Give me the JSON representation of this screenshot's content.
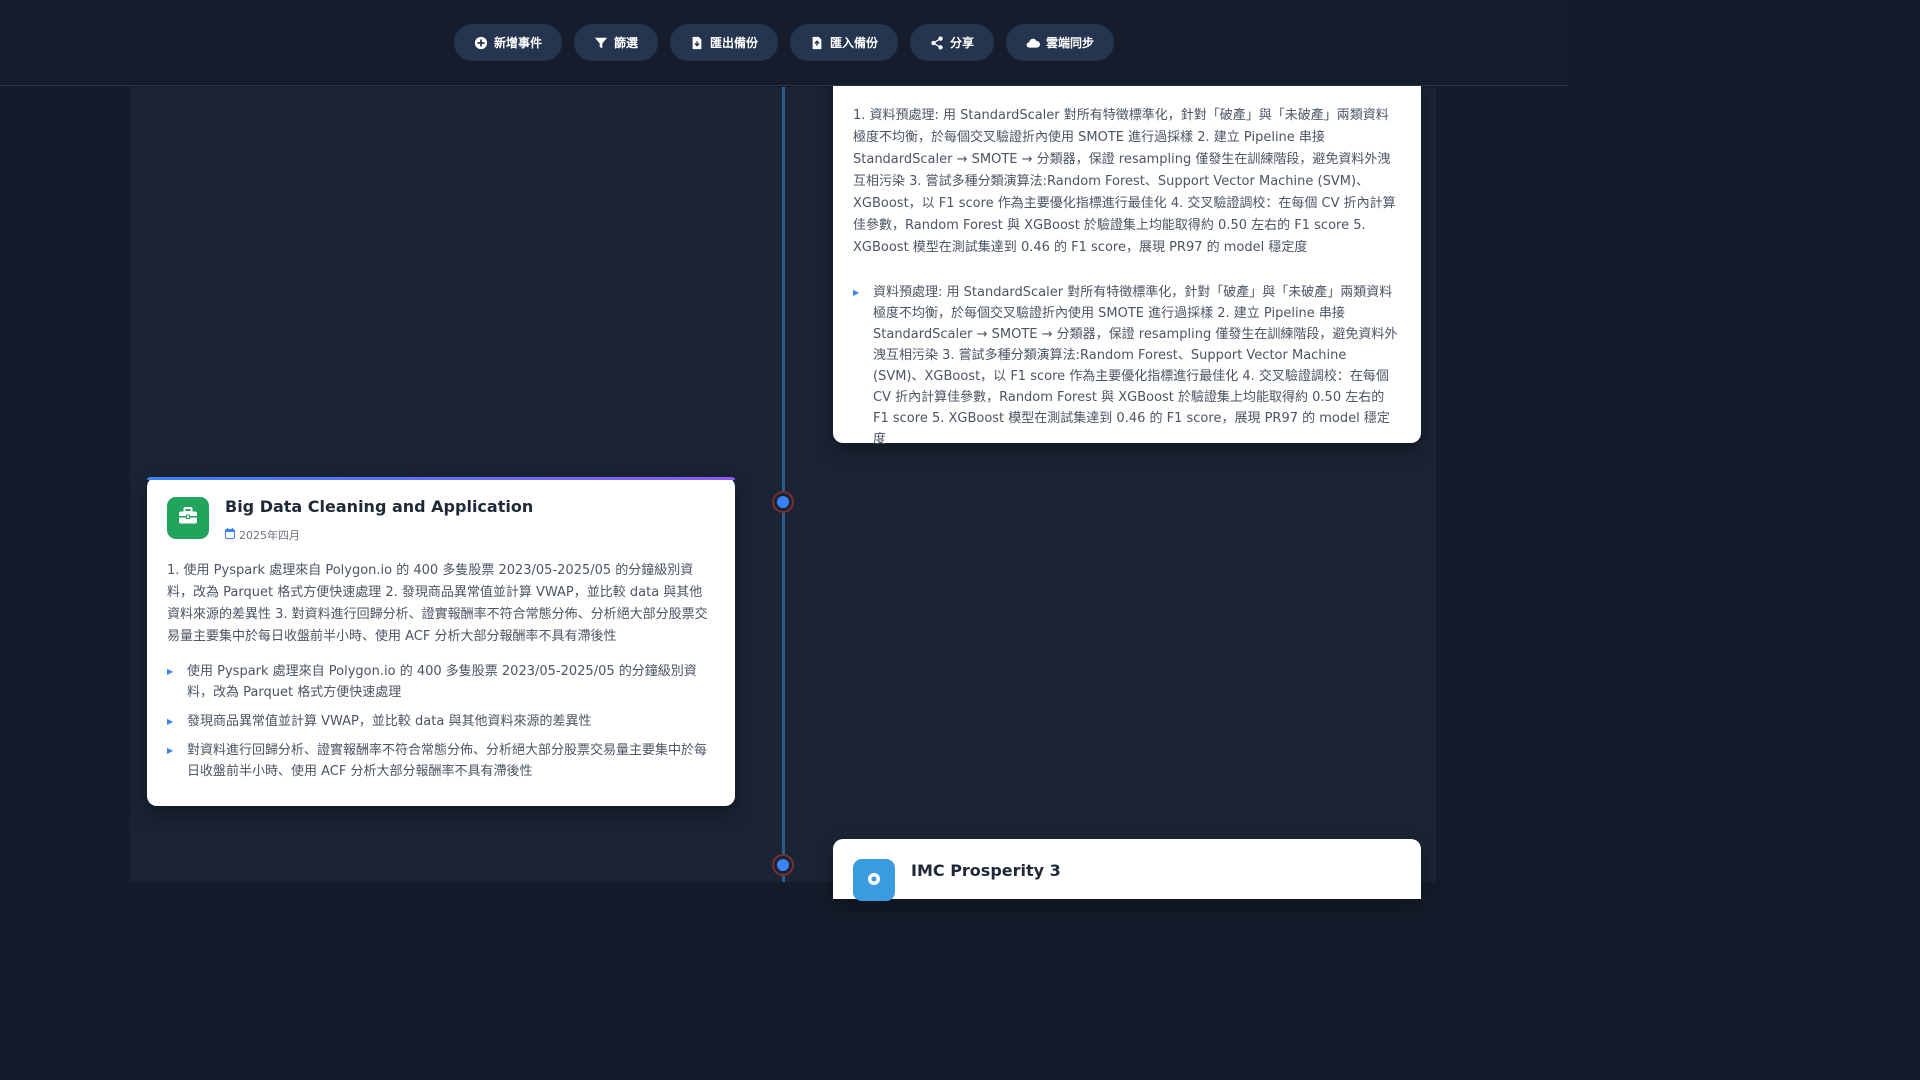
{
  "toolbar": {
    "buttons": [
      {
        "label": "新增事件",
        "icon": "plus-circle-icon"
      },
      {
        "label": "篩選",
        "icon": "filter-icon"
      },
      {
        "label": "匯出備份",
        "icon": "file-export-icon"
      },
      {
        "label": "匯入備份",
        "icon": "file-import-icon"
      },
      {
        "label": "分享",
        "icon": "share-icon"
      },
      {
        "label": "雲端同步",
        "icon": "cloud-icon"
      }
    ]
  },
  "events": [
    {
      "summary": "1. 資料預處理: 用 StandardScaler 對所有特徵標準化，針對「破產」與「未破產」兩類資料極度不均衡，於每個交叉驗證折內使用 SMOTE 進行過採樣 2. 建立 Pipeline 串接 StandardScaler → SMOTE → 分類器，保證 resampling 僅發生在訓練階段，避免資料外洩互相污染 3. 嘗試多種分類演算法:Random Forest、Support Vector Machine (SVM)、XGBoost，以 F1 score 作為主要優化指標進行最佳化 4. 交叉驗證調校：在每個 CV 折內計算佳參數，Random Forest 與 XGBoost 於驗證集上均能取得約 0.50 左右的 F1 score 5. XGBoost 模型在測試集達到 0.46 的 F1 score，展現 PR97 的 model 穩定度",
      "bullets": [
        "資料預處理: 用 StandardScaler 對所有特徵標準化，針對「破產」與「未破產」兩類資料極度不均衡，於每個交叉驗證折內使用 SMOTE 進行過採樣 2. 建立 Pipeline 串接 StandardScaler → SMOTE → 分類器，保證 resampling 僅發生在訓練階段，避免資料外洩互相污染 3. 嘗試多種分類演算法:Random Forest、Support Vector Machine (SVM)、XGBoost，以 F1 score 作為主要優化指標進行最佳化 4. 交叉驗證調校：在每個 CV 折內計算佳參數，Random Forest 與 XGBoost 於驗證集上均能取得約 0.50 左右的 F1 score 5. XGBoost 模型在測試集達到 0.46 的 F1 score，展現 PR97 的 model 穩定度"
      ]
    },
    {
      "title": "Big Data Cleaning and Application",
      "date": "2025年四月",
      "icon": "briefcase-icon",
      "icon_color": "#22a45d",
      "summary": "1. 使用 Pyspark 處理來自 Polygon.io 的 400 多隻股票 2023/05-2025/05 的分鐘級別資料，改為 Parquet 格式方便快速處理 2. 發現商品異常值並計算 VWAP，並比較 data 與其他資料來源的差異性 3. 對資料進行回歸分析、證實報酬率不符合常態分佈、分析絕大部分股票交易量主要集中於每日收盤前半小時、使用 ACF 分析大部分報酬率不具有滯後性",
      "bullets": [
        "使用 Pyspark 處理來自 Polygon.io 的 400 多隻股票 2023/05-2025/05 的分鐘級別資料，改為 Parquet 格式方便快速處理",
        "發現商品異常值並計算 VWAP，並比較 data 與其他資料來源的差異性",
        "對資料進行回歸分析、證實報酬率不符合常態分佈、分析絕大部分股票交易量主要集中於每日收盤前半小時、使用 ACF 分析大部分報酬率不具有滯後性"
      ]
    },
    {
      "title": "IMC Prosperity 3",
      "icon": "location-icon",
      "icon_color": "#3b9be0"
    }
  ],
  "colors": {
    "background": "#141c2b",
    "panel": "#1a2434",
    "toolbar_button": "#25344f",
    "timeline_dot": "#3b82f6",
    "accent": "#3b82f6"
  }
}
